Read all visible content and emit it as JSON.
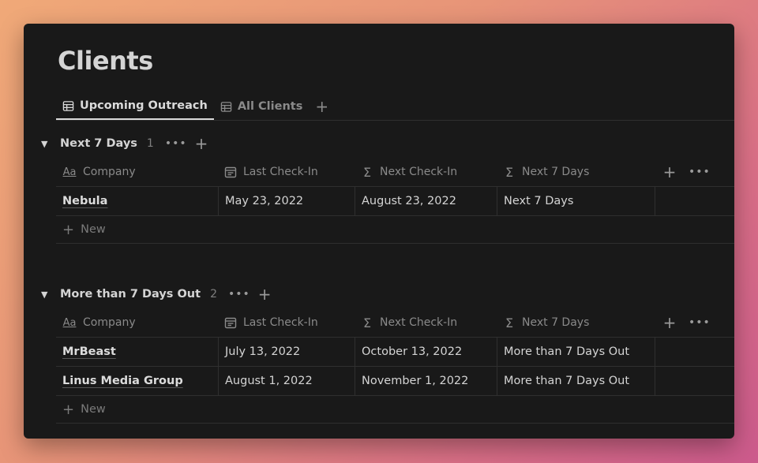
{
  "page": {
    "title": "Clients"
  },
  "tabs": [
    {
      "label": "Upcoming Outreach",
      "active": true,
      "icon": "table-icon"
    },
    {
      "label": "All Clients",
      "active": false,
      "icon": "table-icon"
    }
  ],
  "columns": [
    {
      "label": "Company",
      "icon": "text-property-icon",
      "glyph": "Aa"
    },
    {
      "label": "Last Check-In",
      "icon": "calendar-icon"
    },
    {
      "label": "Next Check-In",
      "icon": "formula-sigma-icon",
      "glyph": "Σ"
    },
    {
      "label": "Next 7 Days",
      "icon": "formula-sigma-icon",
      "glyph": "Σ"
    }
  ],
  "groups": [
    {
      "name": "Next 7 Days",
      "count": "1",
      "rows": [
        {
          "company": "Nebula",
          "last": "May 23, 2022",
          "next": "August 23, 2022",
          "bucket": "Next 7 Days"
        }
      ],
      "new_label": "New"
    },
    {
      "name": "More than 7 Days Out",
      "count": "2",
      "rows": [
        {
          "company": "MrBeast",
          "last": "July 13, 2022",
          "next": "October 13, 2022",
          "bucket": "More than 7 Days Out"
        },
        {
          "company": "Linus Media Group",
          "last": "August 1, 2022",
          "next": "November 1, 2022",
          "bucket": "More than 7 Days Out"
        }
      ],
      "new_label": "New"
    }
  ],
  "colors": {
    "background": "#191919",
    "text": "#d4d4d4",
    "muted": "#8a8a8a",
    "divider": "#2f2f2f"
  }
}
